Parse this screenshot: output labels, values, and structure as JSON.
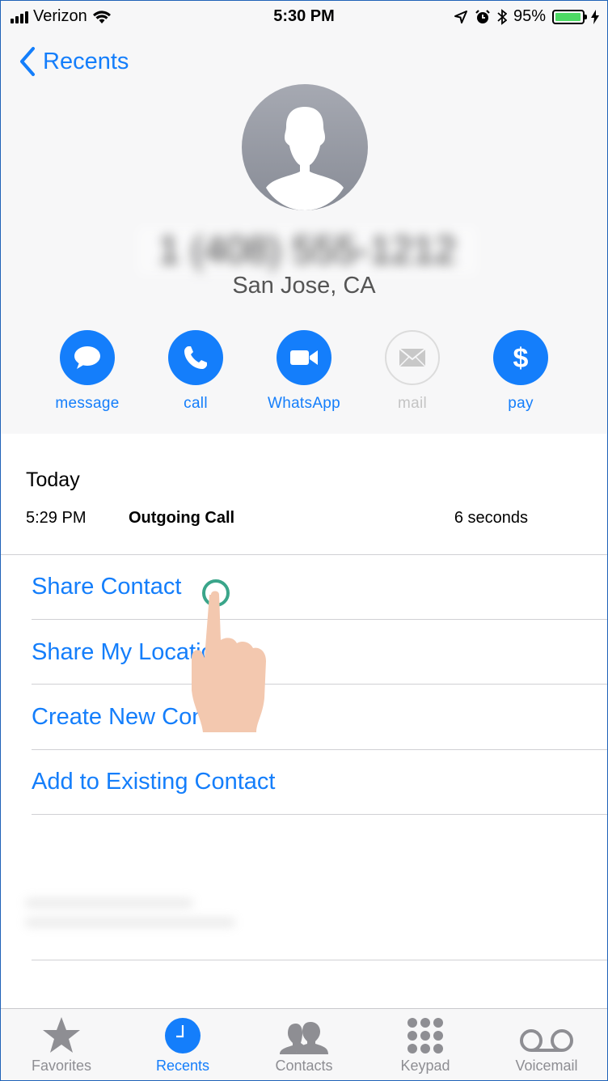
{
  "status_bar": {
    "carrier": "Verizon",
    "time": "5:30 PM",
    "battery": "95%",
    "battery_level": 0.95
  },
  "nav": {
    "back_label": "Recents"
  },
  "contact": {
    "phone": "1 (408) 555-1212",
    "location": "San Jose, CA"
  },
  "actions": [
    {
      "label": "message",
      "icon": "message-bubble-icon",
      "enabled": true
    },
    {
      "label": "call",
      "icon": "phone-icon",
      "enabled": true
    },
    {
      "label": "WhatsApp",
      "icon": "video-camera-icon",
      "enabled": true
    },
    {
      "label": "mail",
      "icon": "envelope-icon",
      "enabled": false
    },
    {
      "label": "pay",
      "icon": "dollar-icon",
      "enabled": true
    }
  ],
  "history": {
    "day": "Today",
    "entries": [
      {
        "time": "5:29 PM",
        "type": "Outgoing Call",
        "duration": "6 seconds"
      }
    ]
  },
  "menu": [
    "Share Contact",
    "Share My Location",
    "Create New Contact",
    "Add to Existing Contact"
  ],
  "tabs": [
    {
      "label": "Favorites",
      "icon": "star-icon",
      "active": false
    },
    {
      "label": "Recents",
      "icon": "clock-icon",
      "active": true
    },
    {
      "label": "Contacts",
      "icon": "contacts-icon",
      "active": false
    },
    {
      "label": "Keypad",
      "icon": "keypad-icon",
      "active": false
    },
    {
      "label": "Voicemail",
      "icon": "voicemail-icon",
      "active": false
    }
  ],
  "colors": {
    "accent": "#147efb",
    "disabled": "#c4c4c4",
    "tab_inactive": "#8e8e93",
    "battery": "#4cd964"
  }
}
